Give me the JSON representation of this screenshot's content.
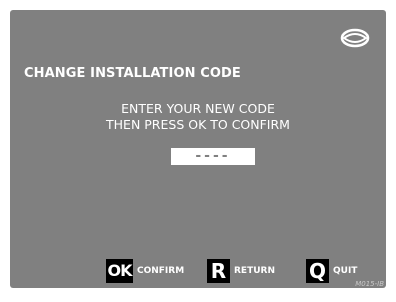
{
  "screen": {
    "title": "CHANGE INSTALLATION CODE",
    "instructions": [
      "ENTER YOUR NEW CODE",
      "THEN PRESS OK TO CONFIRM"
    ],
    "code_field": {
      "value": "----"
    },
    "logo": "brand-logo-icon",
    "colors": {
      "background": "#808080",
      "text": "#ffffff",
      "badge": "#000000"
    }
  },
  "footer": {
    "ok": {
      "key": "OK",
      "label": "CONFIRM"
    },
    "return": {
      "key": "R",
      "label": "RETURN"
    },
    "quit": {
      "key": "Q",
      "label": "QUIT"
    }
  },
  "ref_code": "M015-IB"
}
